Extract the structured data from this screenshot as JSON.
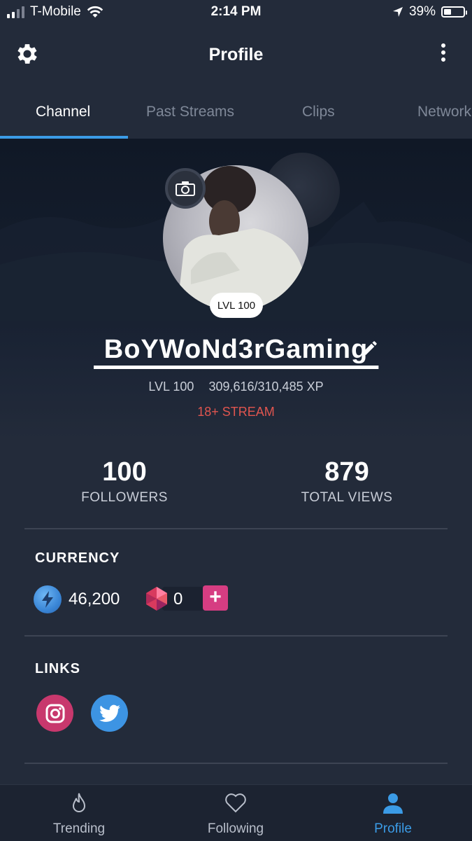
{
  "status_bar": {
    "carrier": "T-Mobile",
    "time": "2:14 PM",
    "battery_percent": "39%",
    "battery_level": 0.39
  },
  "header": {
    "title": "Profile",
    "settings_icon": "gear-icon",
    "more_icon": "vertical-ellipsis-icon"
  },
  "tabs": [
    {
      "label": "Channel",
      "active": true
    },
    {
      "label": "Past Streams",
      "active": false
    },
    {
      "label": "Clips",
      "active": false
    },
    {
      "label": "Network",
      "active": false
    }
  ],
  "profile": {
    "level_badge": "LVL 100",
    "username": "BoYWoNd3rGaming",
    "level": "LVL 100",
    "xp": "309,616/310,485 XP",
    "xp_progress": 0.997,
    "stream_tag": "18+ STREAM"
  },
  "stats": {
    "followers": {
      "value": "100",
      "label": "FOLLOWERS"
    },
    "views": {
      "value": "879",
      "label": "TOTAL VIEWS"
    }
  },
  "currency": {
    "title": "CURRENCY",
    "coins": "46,200",
    "gems": "0",
    "add_label": "+"
  },
  "links": {
    "title": "LINKS",
    "items": [
      "instagram-icon",
      "twitter-icon"
    ]
  },
  "bottom_nav": [
    {
      "label": "Trending",
      "icon": "flame-icon",
      "active": false
    },
    {
      "label": "Following",
      "icon": "heart-icon",
      "active": false
    },
    {
      "label": "Profile",
      "icon": "person-icon",
      "active": true
    }
  ],
  "colors": {
    "background": "#232b3a",
    "accent": "#3b9be6",
    "stream_tag": "#e0554f",
    "add_button": "#d63d82",
    "instagram": "#c8386d",
    "twitter": "#3d94e3"
  }
}
